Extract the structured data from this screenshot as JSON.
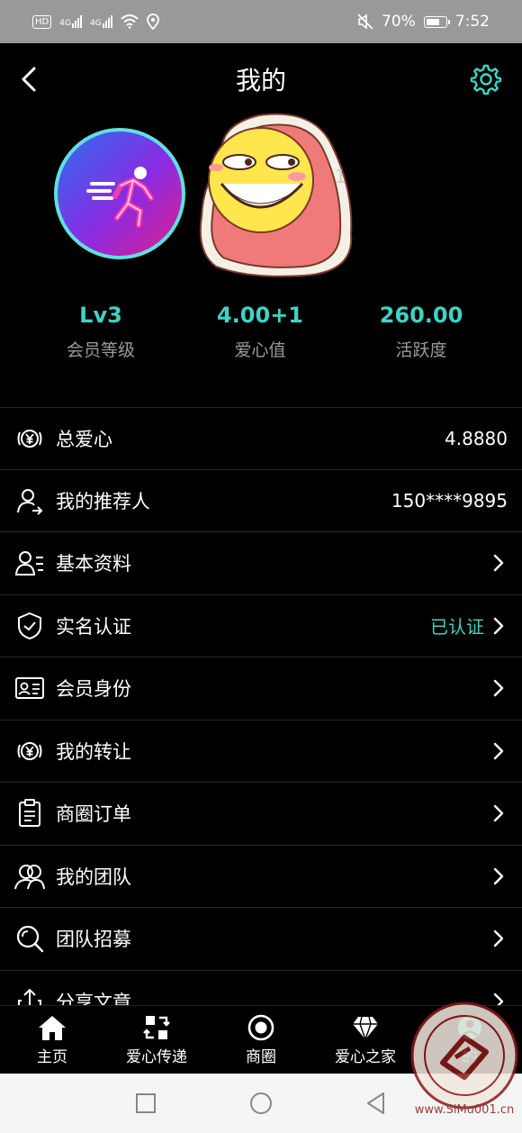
{
  "status_bar": {
    "left_badge": "HD",
    "signal1": "4G",
    "signal2": "4G",
    "battery_pct": "70%",
    "time": "7:52"
  },
  "header": {
    "title": "我的"
  },
  "profile": {
    "uid_fragment": "1"
  },
  "stats": [
    {
      "value": "Lv3",
      "label": "会员等级"
    },
    {
      "value": "4.00+1",
      "label": "爱心值"
    },
    {
      "value": "260.00",
      "label": "活跃度"
    }
  ],
  "menu": [
    {
      "label": "总爱心",
      "value": "4.8880",
      "icon": "yuan-heart-icon"
    },
    {
      "label": "我的推荐人",
      "value": "150****9895",
      "icon": "user-arrow-icon"
    },
    {
      "label": "基本资料",
      "value": "",
      "icon": "user-list-icon"
    },
    {
      "label": "实名认证",
      "value": "已认证",
      "icon": "shield-check-icon"
    },
    {
      "label": "会员身份",
      "value": "",
      "icon": "id-card-icon"
    },
    {
      "label": "我的转让",
      "value": "",
      "icon": "yuan-transfer-icon"
    },
    {
      "label": "商圈订单",
      "value": "",
      "icon": "clipboard-icon"
    },
    {
      "label": "我的团队",
      "value": "",
      "icon": "team-icon"
    },
    {
      "label": "团队招募",
      "value": "",
      "icon": "search-icon"
    },
    {
      "label": "分享文章",
      "value": "",
      "icon": "share-icon"
    }
  ],
  "bottom_nav": [
    {
      "label": "主页",
      "icon": "home-icon"
    },
    {
      "label": "爱心传递",
      "icon": "exchange-icon"
    },
    {
      "label": "商圈",
      "icon": "circle-target-icon"
    },
    {
      "label": "爱心之家",
      "icon": "diamond-icon"
    },
    {
      "label": "的",
      "icon": "profile-icon"
    }
  ],
  "watermark": {
    "text": "www.SiMu001.cn"
  },
  "colors": {
    "accent": "#3fd3c4",
    "background": "#000000",
    "divider": "#2a2a2a"
  }
}
